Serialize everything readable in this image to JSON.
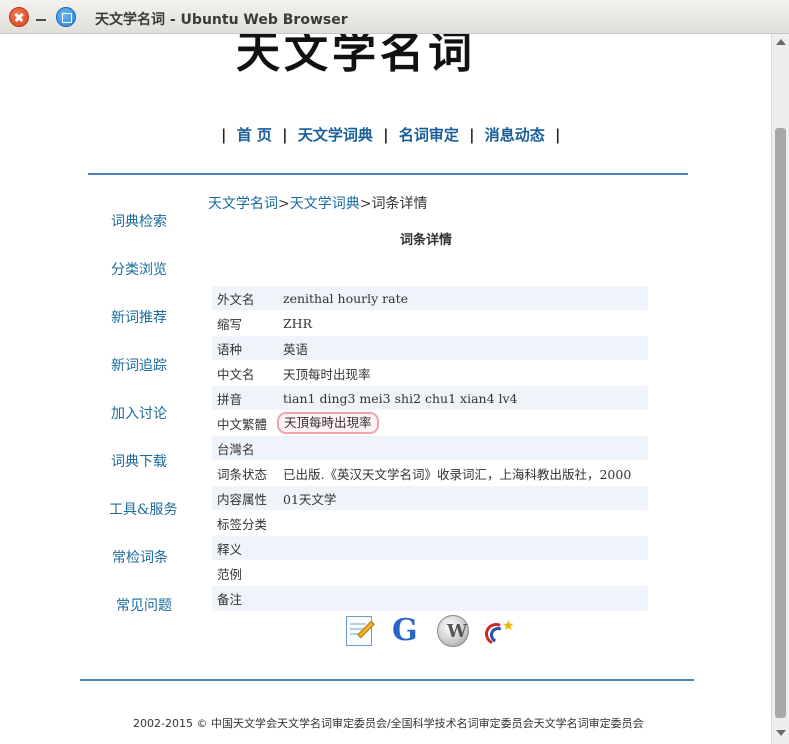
{
  "window": {
    "title": "天文学名词 - Ubuntu Web Browser"
  },
  "site": {
    "logo_text": "天文学名词"
  },
  "topnav": {
    "items": [
      "首 页",
      "天文学词典",
      "名词审定",
      "消息动态"
    ],
    "separator": "|"
  },
  "sidebar": {
    "items": [
      "词典检索",
      "分类浏览",
      "新词推荐",
      "新词追踪",
      "加入讨论",
      "词典下载",
      "工具&服务",
      "常检词条",
      "常见问题"
    ]
  },
  "breadcrumb": {
    "items": [
      "天文学名词",
      "天文学词典",
      "词条详情"
    ],
    "separator": ">"
  },
  "detail": {
    "title": "词条详情",
    "rows": [
      {
        "label": "外文名",
        "value": "zenithal hourly rate"
      },
      {
        "label": "缩写",
        "value": "ZHR"
      },
      {
        "label": "语种",
        "value": "英语"
      },
      {
        "label": "中文名",
        "value": "天顶每时出现率"
      },
      {
        "label": "拼音",
        "value": "tian1 ding3 mei3 shi2 chu1 xian4 lv4"
      },
      {
        "label": "中文繁體",
        "value": "天頂每時出現率"
      },
      {
        "label": "台灣名",
        "value": ""
      },
      {
        "label": "词条状态",
        "value": "已出版.《英汉天文学名词》收录词汇，上海科教出版社，2000"
      },
      {
        "label": "内容属性",
        "value": "01天文学"
      },
      {
        "label": "标签分类",
        "value": ""
      },
      {
        "label": "释义",
        "value": ""
      },
      {
        "label": "范例",
        "value": ""
      },
      {
        "label": "备注",
        "value": ""
      }
    ]
  },
  "icons": [
    "edit-icon",
    "google-icon",
    "wikipedia-icon",
    "partner-logo-icon"
  ],
  "icon_text": {
    "google": "G",
    "wiki": "W"
  },
  "footer": {
    "text": "2002-2015 © 中国天文学会天文学名词审定委员会/全国科学技术名词审定委员会天文学名词审定委员会"
  }
}
